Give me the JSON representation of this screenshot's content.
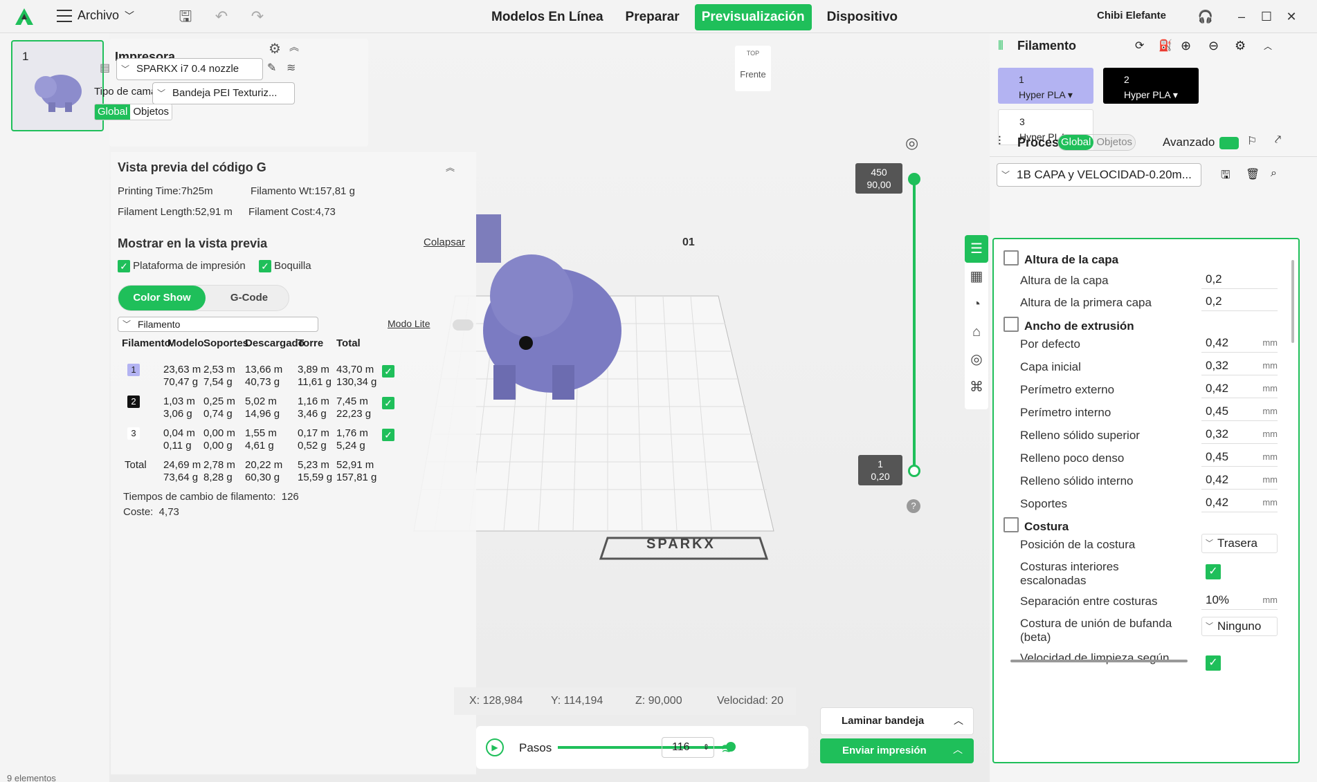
{
  "topbar": {
    "archivo": "Archivo",
    "tabs": [
      "Modelos En Línea",
      "Preparar",
      "Previsualización",
      "Dispositivo"
    ],
    "active_tab": "Previsualización",
    "user": "Chibi Elefante"
  },
  "plate": {
    "number": "1"
  },
  "printer": {
    "title": "Impresora",
    "name": "SPARKX i7 0.4 nozzle",
    "bed_label": "Tipo de cama",
    "bed_value": "Bandeja PEI Texturiz...",
    "scope": [
      "Global",
      "Objetos"
    ]
  },
  "gcode": {
    "title": "Vista previa del código G",
    "printing_time": "Printing Time:7h25m",
    "filament_wt": "Filamento Wt:157,81 g",
    "filament_length": "Filament Length:52,91 m",
    "filament_cost": "Filament Cost:4,73",
    "show_title": "Mostrar en la vista previa",
    "collapse": "Colapsar",
    "chk_plate": "Plataforma de impresión",
    "chk_nozzle": "Boquilla",
    "btn_color": "Color Show",
    "btn_gcode": "G-Code",
    "dropdown": "Filamento",
    "modo_lite": "Modo Lite",
    "headers": [
      "Filamento",
      "Modelo",
      "Soportes",
      "Descargado",
      "Torre",
      "Total"
    ],
    "rows": [
      {
        "id": "1",
        "modelo": "23,63 m\n70,47 g",
        "soportes": "2,53 m\n7,54 g",
        "descargado": "13,66 m\n40,73 g",
        "torre": "3,89 m\n11,61 g",
        "total": "43,70 m\n130,34 g"
      },
      {
        "id": "2",
        "modelo": "1,03 m\n3,06 g",
        "soportes": "0,25 m\n0,74 g",
        "descargado": "5,02 m\n14,96 g",
        "torre": "1,16 m\n3,46 g",
        "total": "7,45 m\n22,23 g"
      },
      {
        "id": "3",
        "modelo": "0,04 m\n0,11 g",
        "soportes": "0,00 m\n0,00 g",
        "descargado": "1,55 m\n4,61 g",
        "torre": "0,17 m\n0,52 g",
        "total": "1,76 m\n5,24 g"
      }
    ],
    "total_row": {
      "label": "Total",
      "modelo": "24,69 m\n73,64 g",
      "soportes": "2,78 m\n8,28 g",
      "descargado": "20,22 m\n60,30 g",
      "torre": "5,23 m\n15,59 g",
      "total": "52,91 m\n157,81 g"
    },
    "change_times": "Tiempos de cambio de filamento:  126",
    "cost": "Coste:  4,73"
  },
  "view": {
    "top": "TOP",
    "front": "Frente",
    "plate_label": "01",
    "brand": "SPARKX"
  },
  "layer_slider": {
    "top_layer": "450",
    "top_height": "90,00",
    "bottom_layer": "1",
    "bottom_height": "0,20"
  },
  "coords": {
    "x": "X: 128,984",
    "y": "Y: 114,194",
    "z": "Z: 90,000",
    "speed": "Velocidad: 20"
  },
  "steps": {
    "label": "Pasos",
    "value": "116",
    "fill_pct": 100
  },
  "actions": {
    "slice": "Laminar bandeja",
    "send": "Enviar impresión"
  },
  "filament_panel": {
    "title": "Filamento",
    "items": [
      {
        "num": "1",
        "type": "Hyper PLA",
        "color": "#b3b3f2",
        "text": "#222"
      },
      {
        "num": "2",
        "type": "Hyper PLA",
        "color": "#000000",
        "text": "#ffffff"
      },
      {
        "num": "3",
        "type": "Hyper PLA",
        "color": "#ffffff",
        "text": "#222"
      }
    ]
  },
  "process": {
    "title": "Proceso",
    "scope": [
      "Global",
      "Objetos"
    ],
    "advanced": "Avanzado",
    "preset": "1B CAPA y VELOCIDAD-0.20m..."
  },
  "params": {
    "sec_layer": "Altura de la capa",
    "layer_height": {
      "label": "Altura de la capa",
      "value": "0,2"
    },
    "first_layer": {
      "label": "Altura de la primera capa",
      "value": "0,2"
    },
    "sec_width": "Ancho de extrusión",
    "widths": [
      {
        "label": "Por defecto",
        "value": "0,42"
      },
      {
        "label": "Capa inicial",
        "value": "0,32"
      },
      {
        "label": "Perímetro externo",
        "value": "0,42"
      },
      {
        "label": "Perímetro interno",
        "value": "0,45"
      },
      {
        "label": "Relleno sólido superior",
        "value": "0,32"
      },
      {
        "label": "Relleno poco denso",
        "value": "0,45"
      },
      {
        "label": "Relleno sólido interno",
        "value": "0,42"
      },
      {
        "label": "Soportes",
        "value": "0,42"
      }
    ],
    "unit": "mm",
    "sec_seam": "Costura",
    "seam_pos": {
      "label": "Posición de la costura",
      "value": "Trasera"
    },
    "staggered": {
      "label": "Costuras interiores escalonadas"
    },
    "seam_gap": {
      "label": "Separación entre costuras",
      "value": "10%"
    },
    "scarf": {
      "label": "Costura de unión de bufanda (beta)",
      "value": "Ninguno"
    },
    "wipe": {
      "label": "Velocidad de limpieza según"
    }
  },
  "status": "9 elementos"
}
